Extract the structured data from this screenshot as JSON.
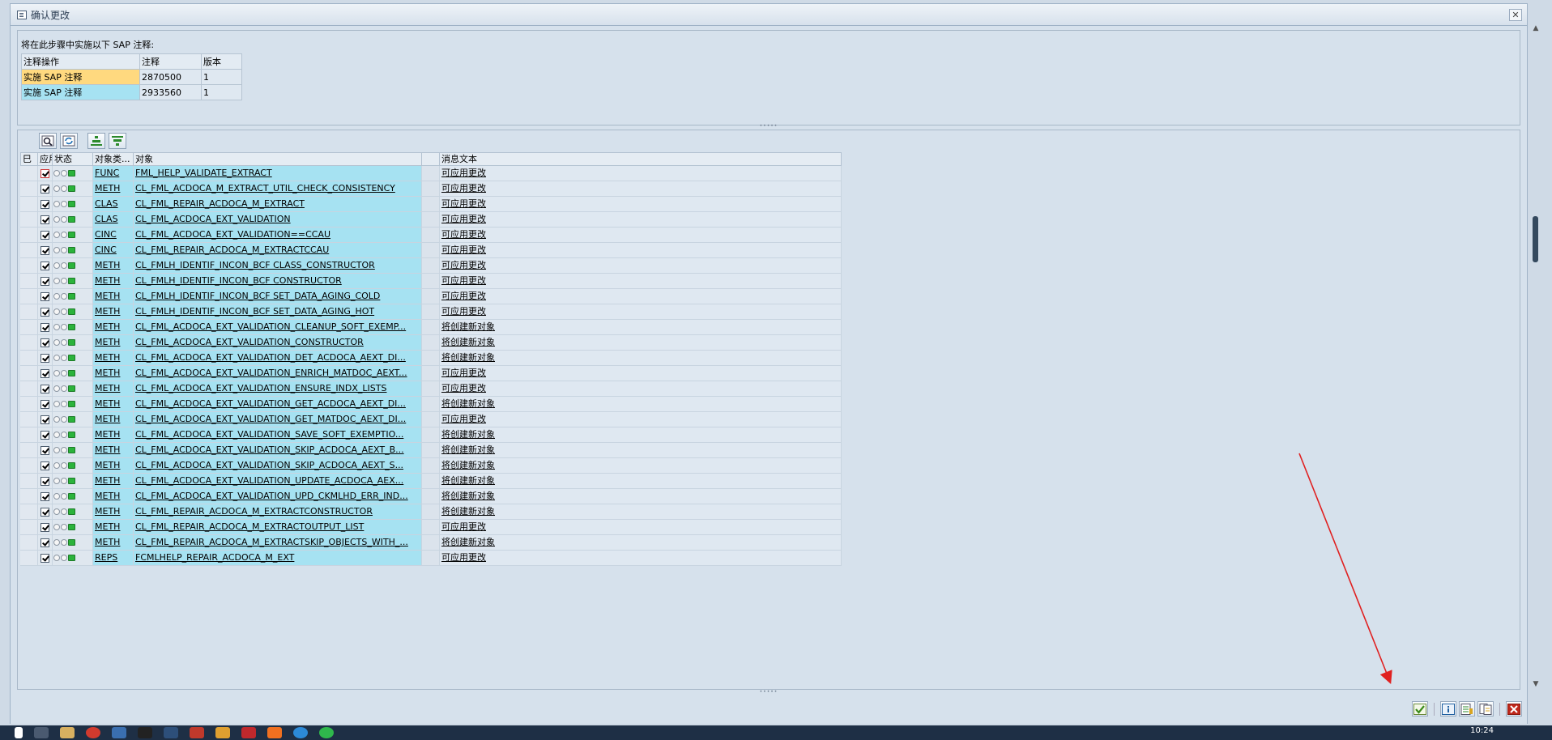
{
  "window": {
    "title": "确认更改"
  },
  "notes_section": {
    "caption": "将在此步骤中实施以下 SAP 注释:",
    "headers": [
      "注释操作",
      "注释",
      "版本"
    ],
    "rows": [
      {
        "action": "实施 SAP 注释",
        "note": "2870500",
        "version": "1",
        "color": "#ffd97f"
      },
      {
        "action": "实施 SAP 注释",
        "note": "2933560",
        "version": "1",
        "color": "#a6e2f2"
      }
    ]
  },
  "grid": {
    "headers": {
      "sel": "巳",
      "apply": "应用",
      "status": "状态",
      "type": "对象类...",
      "object": "对象",
      "message": "消息文本"
    },
    "rows": [
      {
        "type": "FUNC",
        "object": "FML_HELP_VALIDATE_EXTRACT",
        "message": "可应用更改"
      },
      {
        "type": "METH",
        "object": "CL_FML_ACDOCA_M_EXTRACT_UTIL_CHECK_CONSISTENCY",
        "message": "可应用更改"
      },
      {
        "type": "CLAS",
        "object": "CL_FML_REPAIR_ACDOCA_M_EXTRACT",
        "message": "可应用更改"
      },
      {
        "type": "CLAS",
        "object": "CL_FML_ACDOCA_EXT_VALIDATION",
        "message": "可应用更改"
      },
      {
        "type": "CINC",
        "object": "CL_FML_ACDOCA_EXT_VALIDATION==CCAU",
        "message": "可应用更改"
      },
      {
        "type": "CINC",
        "object": "CL_FML_REPAIR_ACDOCA_M_EXTRACTCCAU",
        "message": "可应用更改"
      },
      {
        "type": "METH",
        "object": "CL_FMLH_IDENTIF_INCON_BCF    CLASS_CONSTRUCTOR",
        "message": "可应用更改"
      },
      {
        "type": "METH",
        "object": "CL_FMLH_IDENTIF_INCON_BCF    CONSTRUCTOR",
        "message": "可应用更改"
      },
      {
        "type": "METH",
        "object": "CL_FMLH_IDENTIF_INCON_BCF    SET_DATA_AGING_COLD",
        "message": "可应用更改"
      },
      {
        "type": "METH",
        "object": "CL_FMLH_IDENTIF_INCON_BCF    SET_DATA_AGING_HOT",
        "message": "可应用更改"
      },
      {
        "type": "METH",
        "object": "CL_FML_ACDOCA_EXT_VALIDATION_CLEANUP_SOFT_EXEMP...",
        "message": "将创建新对象"
      },
      {
        "type": "METH",
        "object": "CL_FML_ACDOCA_EXT_VALIDATION_CONSTRUCTOR",
        "message": "将创建新对象"
      },
      {
        "type": "METH",
        "object": "CL_FML_ACDOCA_EXT_VALIDATION_DET_ACDOCA_AEXT_DI...",
        "message": "将创建新对象"
      },
      {
        "type": "METH",
        "object": "CL_FML_ACDOCA_EXT_VALIDATION_ENRICH_MATDOC_AEXT...",
        "message": "可应用更改"
      },
      {
        "type": "METH",
        "object": "CL_FML_ACDOCA_EXT_VALIDATION_ENSURE_INDX_LISTS",
        "message": "可应用更改"
      },
      {
        "type": "METH",
        "object": "CL_FML_ACDOCA_EXT_VALIDATION_GET_ACDOCA_AEXT_DI...",
        "message": "将创建新对象"
      },
      {
        "type": "METH",
        "object": "CL_FML_ACDOCA_EXT_VALIDATION_GET_MATDOC_AEXT_DI...",
        "message": "可应用更改"
      },
      {
        "type": "METH",
        "object": "CL_FML_ACDOCA_EXT_VALIDATION_SAVE_SOFT_EXEMPTIO...",
        "message": "将创建新对象"
      },
      {
        "type": "METH",
        "object": "CL_FML_ACDOCA_EXT_VALIDATION_SKIP_ACDOCA_AEXT_B...",
        "message": "将创建新对象"
      },
      {
        "type": "METH",
        "object": "CL_FML_ACDOCA_EXT_VALIDATION_SKIP_ACDOCA_AEXT_S...",
        "message": "将创建新对象"
      },
      {
        "type": "METH",
        "object": "CL_FML_ACDOCA_EXT_VALIDATION_UPDATE_ACDOCA_AEX...",
        "message": "将创建新对象"
      },
      {
        "type": "METH",
        "object": "CL_FML_ACDOCA_EXT_VALIDATION_UPD_CKMLHD_ERR_IND...",
        "message": "将创建新对象"
      },
      {
        "type": "METH",
        "object": "CL_FML_REPAIR_ACDOCA_M_EXTRACTCONSTRUCTOR",
        "message": "将创建新对象"
      },
      {
        "type": "METH",
        "object": "CL_FML_REPAIR_ACDOCA_M_EXTRACTOUTPUT_LIST",
        "message": "可应用更改"
      },
      {
        "type": "METH",
        "object": "CL_FML_REPAIR_ACDOCA_M_EXTRACTSKIP_OBJECTS_WITH_...",
        "message": "将创建新对象"
      },
      {
        "type": "REPS",
        "object": "FCMLHELP_REPAIR_ACDOCA_M_EXT",
        "message": "可应用更改"
      }
    ]
  },
  "taskbar": {
    "clock": "10:24"
  },
  "colors": {
    "accent_arrow": "#e02020",
    "highlight_yellow": "#ffd97f",
    "highlight_cyan": "#a6e2f2"
  }
}
